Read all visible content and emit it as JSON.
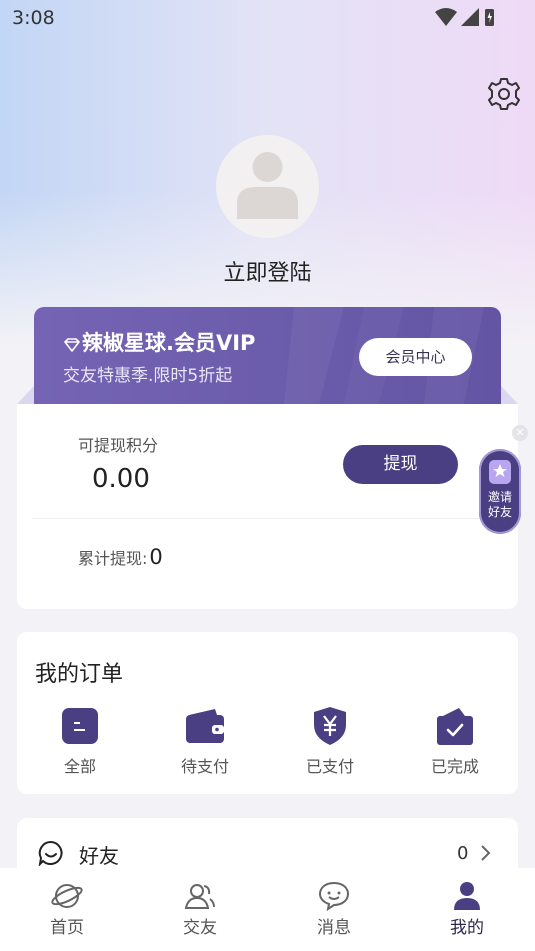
{
  "status_bar": {
    "time": "3:08"
  },
  "profile": {
    "login_text": "立即登陆"
  },
  "vip": {
    "title": "辣椒星球.会员VIP",
    "subtitle": "交友特惠季.限时5折起",
    "center_button": "会员中心"
  },
  "points": {
    "label": "可提现积分",
    "value": "0.00",
    "withdraw_button": "提现",
    "total_label": "累计提现:",
    "total_value": "0"
  },
  "invite": {
    "label_line1": "邀请",
    "label_line2": "好友"
  },
  "orders": {
    "title": "我的订单",
    "items": [
      {
        "label": "全部",
        "icon": "all-orders-icon"
      },
      {
        "label": "待支付",
        "icon": "wallet-icon"
      },
      {
        "label": "已支付",
        "icon": "yen-shield-icon"
      },
      {
        "label": "已完成",
        "icon": "check-box-icon"
      }
    ]
  },
  "friends": {
    "label": "好友",
    "count": "0"
  },
  "tabs": [
    {
      "label": "首页",
      "icon": "planet-icon",
      "active": false
    },
    {
      "label": "交友",
      "icon": "people-icon",
      "active": false
    },
    {
      "label": "消息",
      "icon": "chat-icon",
      "active": false
    },
    {
      "label": "我的",
      "icon": "person-icon",
      "active": true
    }
  ],
  "colors": {
    "accent": "#4b3f84",
    "vip_gradient_start": "#7564b4",
    "vip_gradient_end": "#6354a4",
    "background": "#f3f2f6"
  }
}
